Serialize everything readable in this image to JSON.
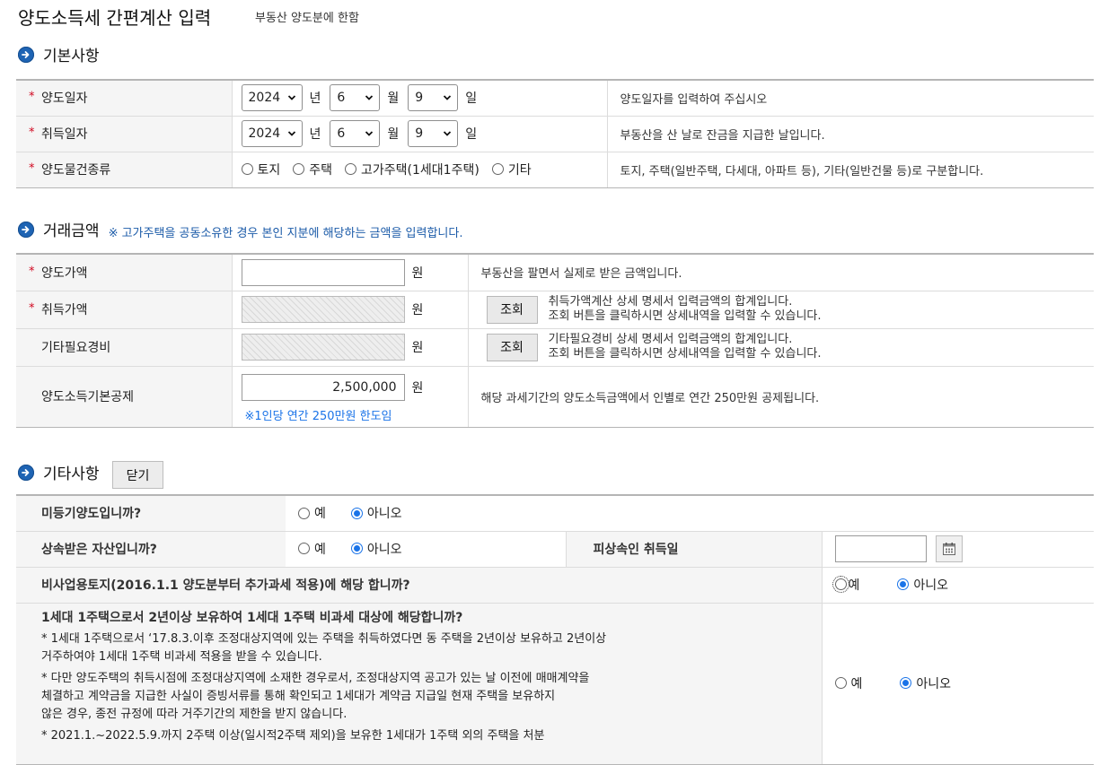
{
  "page": {
    "title": "양도소득세 간편계산 입력",
    "subtitle": "부동산 양도분에 한함"
  },
  "basic": {
    "heading": "기본사항",
    "transfer_date": {
      "label": "양도일자",
      "year": "2024",
      "year_unit": "년",
      "month": "6",
      "month_unit": "월",
      "day": "9",
      "day_unit": "일",
      "desc": "양도일자를 입력하여 주십시오"
    },
    "acquisition_date": {
      "label": "취득일자",
      "year": "2024",
      "year_unit": "년",
      "month": "6",
      "month_unit": "월",
      "day": "9",
      "day_unit": "일",
      "desc": "부동산을 산 날로 잔금을 지급한 날입니다."
    },
    "property_type": {
      "label": "양도물건종류",
      "options": [
        "토지",
        "주택",
        "고가주택(1세대1주택)",
        "기타"
      ],
      "desc": "토지, 주택(일반주택, 다세대, 아파트 등), 기타(일반건물 등)로 구분합니다."
    }
  },
  "amounts": {
    "heading": "거래금액",
    "note": "※ 고가주택을 공동소유한 경우 본인 지분에 해당하는 금액을 입력합니다.",
    "unit": "원",
    "transfer_price": {
      "label": "양도가액",
      "value": "",
      "desc": "부동산을 팔면서 실제로 받은 금액입니다."
    },
    "acquisition_price": {
      "label": "취득가액",
      "button": "조회",
      "desc1": "취득가액계산 상세 명세서 입력금액의 합계입니다.",
      "desc2": "조회 버튼을 클릭하시면 상세내역을 입력할 수 있습니다."
    },
    "other_expenses": {
      "label": "기타필요경비",
      "button": "조회",
      "desc1": "기타필요경비 상세 명세서 입력금액의 합계입니다.",
      "desc2": "조회 버튼을 클릭하시면 상세내역을 입력할 수 있습니다."
    },
    "basic_deduction": {
      "label": "양도소득기본공제",
      "value": "2,500,000",
      "note": "※1인당 연간 250만원 한도임",
      "desc": "해당 과세기간의 양도소득금액에서 인별로 연간 250만원 공제됩니다."
    }
  },
  "other": {
    "heading": "기타사항",
    "close_button": "닫기",
    "yes": "예",
    "no": "아니오",
    "q_unregistered": "미등기양도입니까?",
    "q_inherited": "상속받은 자산입니까?",
    "decedent_label": "피상속인 취득일",
    "decedent_value": "",
    "q_nonbusiness": "비사업용토지(2016.1.1 양도분부터 추가과세 적용)에 해당 합니까?",
    "q_one_house": "1세대 1주택으로서 2년이상 보유하여 1세대 1주택 비과세 대상에 해당합니까?",
    "note1_a": "* 1세대 1주택으로서 ‘17.8.3.이후 조정대상지역에 있는 주택을 취득하였다면 동 주택을 2년이상 보유하고 2년이상",
    "note1_b": "거주하여야 1세대 1주택 비과세 적용을 받을 수 있습니다.",
    "note2_a": "* 다만 양도주택의 취득시점에 조정대상지역에 소재한 경우로서, 조정대상지역 공고가 있는 날 이전에 매매계약을",
    "note2_b": "체결하고 계약금을 지급한 사실이 증빙서류를 통해 확인되고 1세대가 계약금 지급일 현재 주택을 보유하지",
    "note2_c": "않은 경우, 종전 규정에 따라 거주기간의 제한을 받지 않습니다.",
    "note3_a": "* 2021.1.~2022.5.9.까지 2주택 이상(일시적2주택 제외)을 보유한 1세대가 1주택 외의 주택을 처분"
  },
  "icons": {
    "section": "arrow-right-circle-icon",
    "chevron": "chevron-down-icon",
    "calendar": "calendar-icon"
  },
  "colors": {
    "accent": "#1e64b4",
    "required": "#d0021b",
    "note": "#1a5aa8"
  }
}
